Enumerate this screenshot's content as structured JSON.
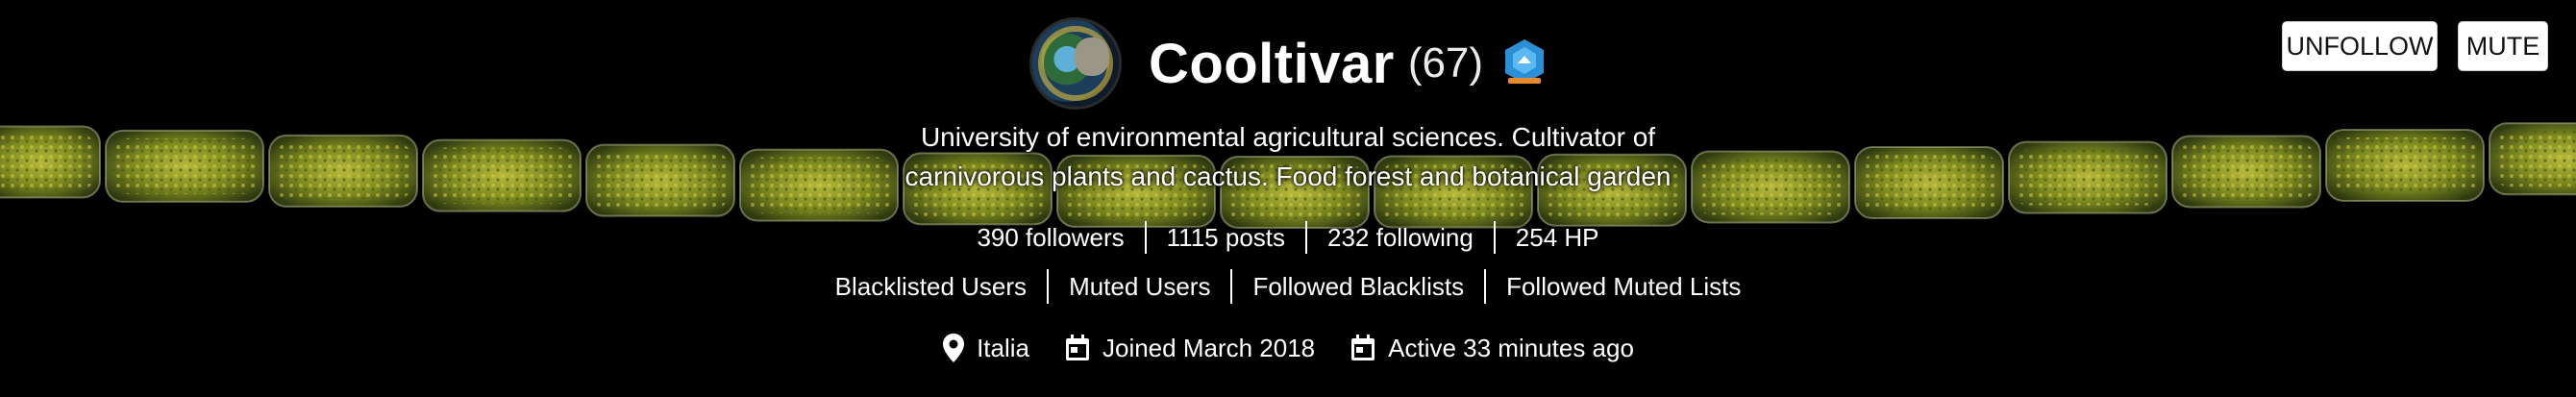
{
  "profile": {
    "username": "Cooltivar",
    "reputation": "(67)",
    "bio": "University of environmental agricultural sciences. Cultivator of carnivorous plants and cactus. Food forest and botanical garden",
    "avatar_icon": "avatar-image",
    "badge_icon": "badge-icon"
  },
  "actions": {
    "unfollow_label": "UNFOLLOW",
    "mute_label": "MUTE"
  },
  "stats": [
    {
      "label": "390 followers"
    },
    {
      "label": "1115 posts"
    },
    {
      "label": "232 following"
    },
    {
      "label": "254 HP"
    }
  ],
  "lists": [
    {
      "label": "Blacklisted Users"
    },
    {
      "label": "Muted Users"
    },
    {
      "label": "Followed Blacklists"
    },
    {
      "label": "Followed Muted Lists"
    }
  ],
  "meta": {
    "location": "Italia",
    "joined": "Joined March 2018",
    "active": "Active 33 minutes ago"
  },
  "colors": {
    "background": "#000000",
    "text": "#ffffff",
    "button_bg": "#ffffff",
    "badge_blue": "#2a8fd4",
    "badge_orange": "#e68a2e",
    "algae_green": "#9aa52a"
  }
}
